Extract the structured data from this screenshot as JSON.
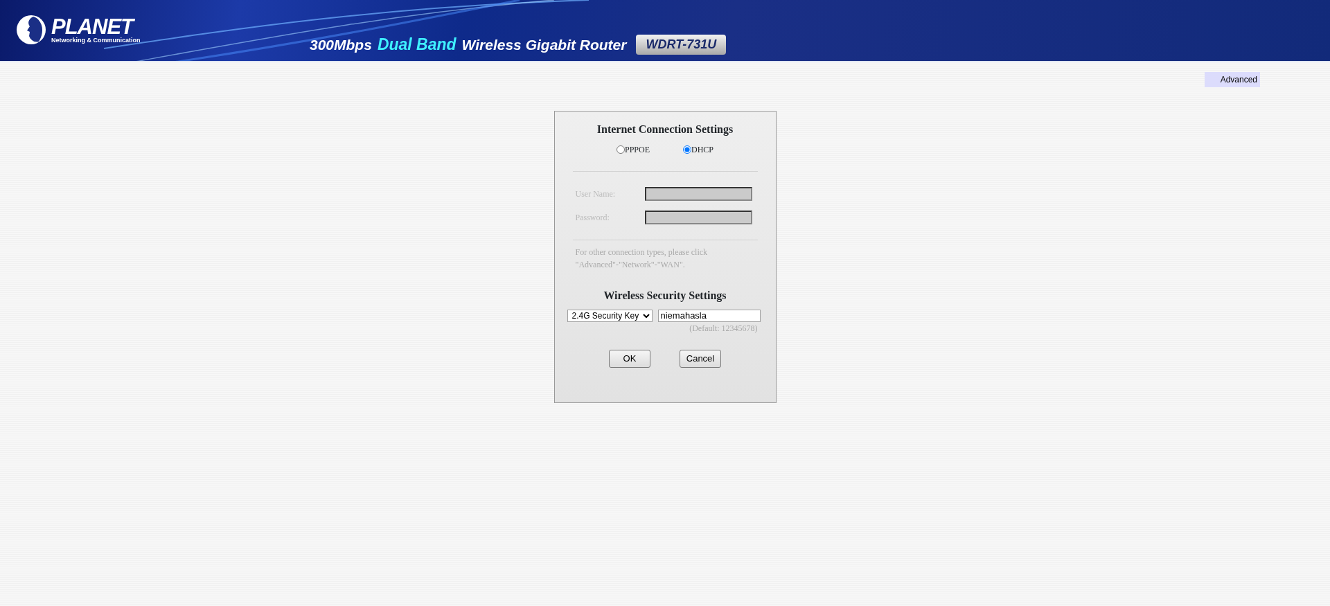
{
  "banner": {
    "brand": "PLANET",
    "tagline": "Networking & Communication",
    "speed": "300Mbps",
    "band": "Dual Band",
    "product": "Wireless Gigabit Router",
    "model": "WDRT-731U"
  },
  "advanced_link": "Advanced",
  "internet": {
    "title": "Internet Connection Settings",
    "options": [
      {
        "label": "PPPOE",
        "selected": false
      },
      {
        "label": "DHCP",
        "selected": true
      }
    ],
    "fields": [
      {
        "label": "User Name:",
        "disabled": true
      },
      {
        "label": "Password:",
        "disabled": true
      }
    ],
    "note": [
      "For other connection types, please click",
      "\"Advanced\"-\"Network\"-\"WAN\"."
    ]
  },
  "wireless": {
    "title": "Wireless Security Settings",
    "key_type": "2.4G Security Key",
    "key_value": "niemahasla",
    "hint": "(Default: 12345678)"
  },
  "buttons": [
    "OK",
    "Cancel"
  ]
}
